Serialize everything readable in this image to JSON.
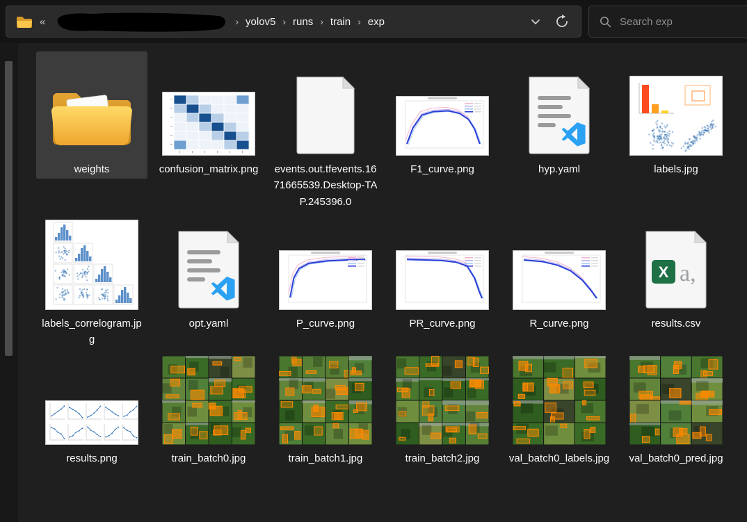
{
  "address_bar": {
    "folder_icon": "folder-icon",
    "collapse_glyph": "«",
    "redaction_icon": "redaction-scribble",
    "separator": "›",
    "breadcrumbs": [
      "yolov5",
      "runs",
      "train",
      "exp"
    ],
    "dropdown_icon": "chevron-down-icon",
    "refresh_icon": "refresh-icon"
  },
  "search": {
    "placeholder": "Search exp",
    "icon": "search-icon"
  },
  "files": [
    {
      "name": "weights",
      "type": "folder",
      "selected": true
    },
    {
      "name": "confusion_matrix.png",
      "type": "confusion-matrix",
      "selected": false
    },
    {
      "name": "events.out.tfevents.1671665539.Desktop-TAP.245396.0",
      "type": "document",
      "selected": false
    },
    {
      "name": "F1_curve.png",
      "type": "curve-f1",
      "selected": false
    },
    {
      "name": "hyp.yaml",
      "type": "yaml",
      "selected": false
    },
    {
      "name": "labels.jpg",
      "type": "labels",
      "selected": false
    },
    {
      "name": "labels_correlogram.jpg",
      "type": "correlogram",
      "selected": false
    },
    {
      "name": "opt.yaml",
      "type": "yaml",
      "selected": false
    },
    {
      "name": "P_curve.png",
      "type": "curve-p",
      "selected": false
    },
    {
      "name": "PR_curve.png",
      "type": "curve-pr",
      "selected": false
    },
    {
      "name": "R_curve.png",
      "type": "curve-r",
      "selected": false
    },
    {
      "name": "results.csv",
      "type": "excel",
      "selected": false
    },
    {
      "name": "results.png",
      "type": "results-grid",
      "selected": false
    },
    {
      "name": "train_batch0.jpg",
      "type": "mosaic",
      "selected": false
    },
    {
      "name": "train_batch1.jpg",
      "type": "mosaic",
      "selected": false
    },
    {
      "name": "train_batch2.jpg",
      "type": "mosaic",
      "selected": false
    },
    {
      "name": "val_batch0_labels.jpg",
      "type": "mosaic",
      "selected": false
    },
    {
      "name": "val_batch0_pred.jpg",
      "type": "mosaic",
      "selected": false
    }
  ],
  "colors": {
    "background": "#1f1f1f",
    "topbar": "#141414",
    "address_bar_bg": "#2b2b2b",
    "search_bg": "#1c1c1c",
    "border": "#3d3d3d",
    "text": "#f2f2f2",
    "selection": "rgba(255,255,255,0.13)",
    "folder_yellow": "#f7c342",
    "excel_green": "#1e7145",
    "vscode_blue": "#2aa1f3",
    "plot_blue": "#2b6cb0",
    "bar_orange": "#ff4a1f",
    "box_orange": "#ff8a00"
  }
}
